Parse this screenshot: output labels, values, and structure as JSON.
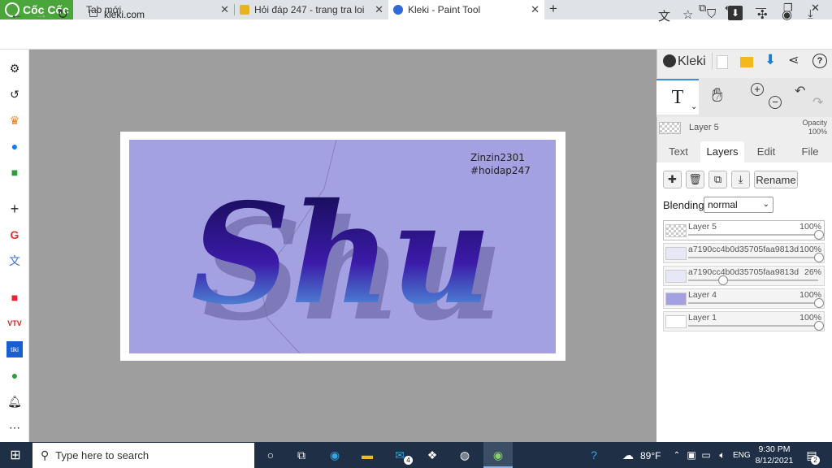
{
  "browser": {
    "brand": "Cốc Cốc",
    "tabs": [
      {
        "label": "Tab mới"
      },
      {
        "label": "Hỏi đáp 247 - trang tra loi"
      },
      {
        "label": "Kleki - Paint Tool"
      }
    ],
    "url": "kleki.com"
  },
  "canvas": {
    "watermark_line1": "Zinzin2301",
    "watermark_line2": "#hoidap247",
    "art_text": "Shu",
    "bg_color": "#a4a1e3"
  },
  "kleki": {
    "logo": "Kleki",
    "active_tool_glyph": "T",
    "current_layer": {
      "name": "Layer 5",
      "opacity_label": "Opacity",
      "opacity_value": "100%"
    },
    "tabs": [
      "Text",
      "Layers",
      "Edit",
      "File"
    ],
    "rename_label": "Rename",
    "blending_label": "Blending",
    "blending_value": "normal",
    "layers": [
      {
        "name": "Layer 5",
        "opacity": "100%",
        "level": 1.0
      },
      {
        "name": "a7190cc4b0d35705faa9813d",
        "opacity": "100%",
        "level": 1.0
      },
      {
        "name": "a7190cc4b0d35705faa9813d",
        "opacity": "26%",
        "level": 0.26
      },
      {
        "name": "Layer 4",
        "opacity": "100%",
        "level": 1.0
      },
      {
        "name": "Layer 1",
        "opacity": "100%",
        "level": 1.0
      }
    ]
  },
  "taskbar": {
    "search_placeholder": "Type here to search",
    "mail_badge": "4",
    "weather": "89°F",
    "lang": "ENG",
    "time": "9:30 PM",
    "date": "8/12/2021",
    "notif_count": "2"
  }
}
